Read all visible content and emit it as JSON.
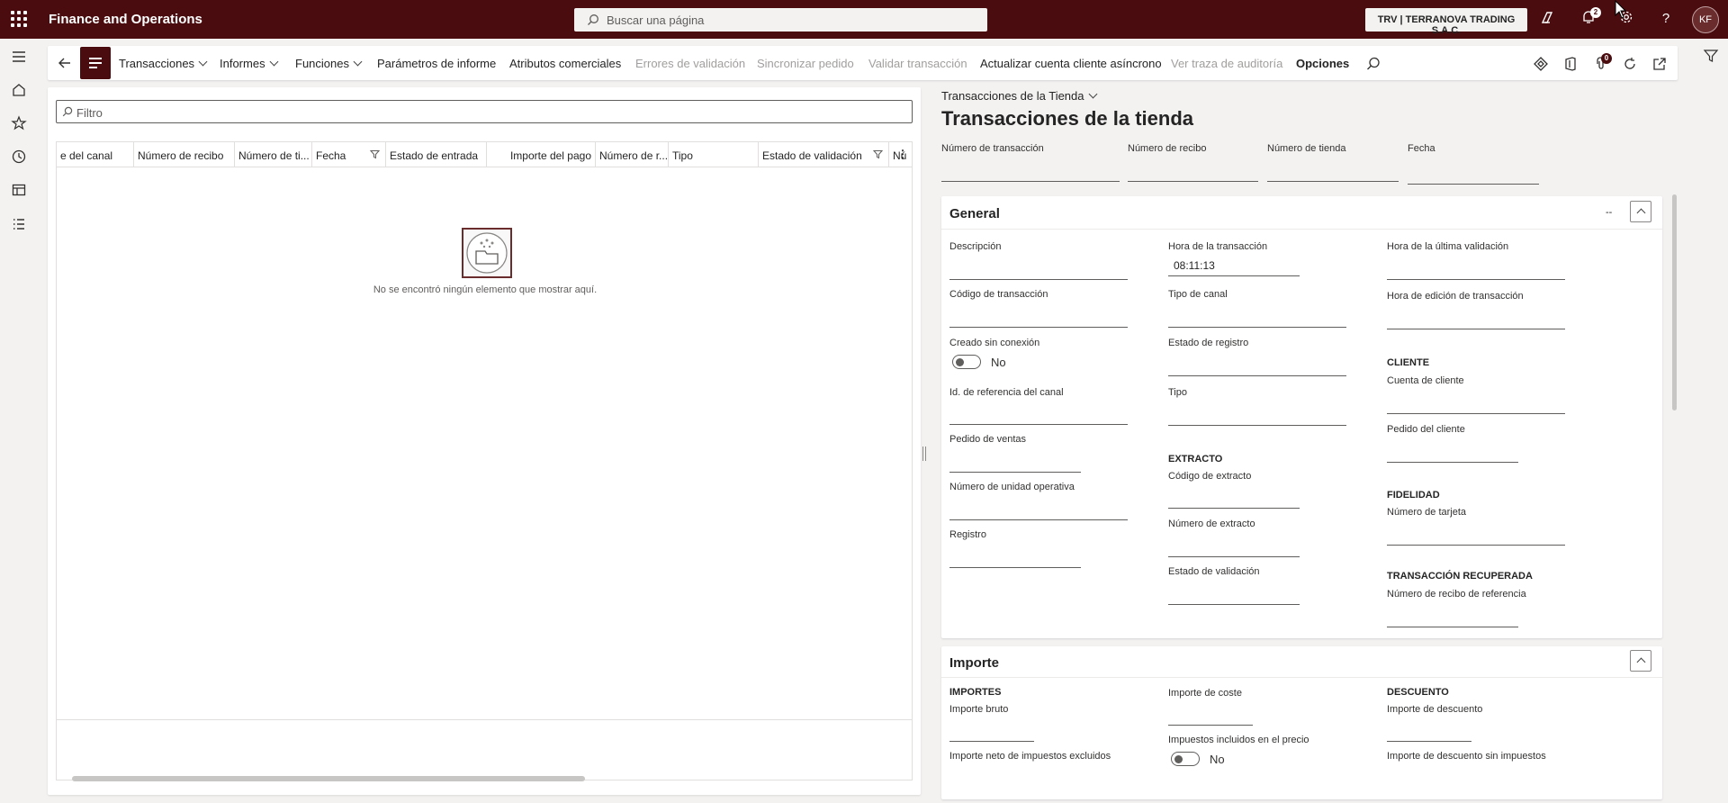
{
  "topbar": {
    "app_name": "Finance and Operations",
    "search_placeholder": "Buscar una página",
    "company": "TRV | TERRANOVA TRADING S.A.C.",
    "notifications_count": "2",
    "avatar_initials": "KF"
  },
  "actions": {
    "transacciones": "Transacciones",
    "informes": "Informes",
    "funciones": "Funciones",
    "parametros": "Parámetros de informe",
    "atributos": "Atributos comerciales",
    "errores": "Errores de validación",
    "sincronizar": "Sincronizar pedido",
    "validar": "Validar transacción",
    "actualizar": "Actualizar cuenta cliente asíncrono",
    "traza": "Ver traza de auditoría",
    "opciones": "Opciones",
    "attach_count": "0"
  },
  "list": {
    "filter_placeholder": "Filtro",
    "columns": [
      "e del canal",
      "Número de recibo",
      "Número de ti...",
      "Fecha",
      "Estado de entrada",
      "Importe del pago",
      "Número de r...",
      "Tipo",
      "Estado de validación",
      "Nú"
    ],
    "empty_message": "No se encontró ningún elemento que mostrar aquí."
  },
  "detail": {
    "breadcrumb": "Transacciones de la Tienda",
    "title": "Transacciones de la tienda",
    "header_fields": [
      "Número de transacción",
      "Número de recibo",
      "Número de tienda",
      "Fecha"
    ],
    "general": {
      "title": "General",
      "dash": "--",
      "descripcion": "Descripción",
      "hora_transaccion": "Hora de la transacción",
      "hora_transaccion_value": "08:11:13",
      "hora_ultima_validacion": "Hora de la última validación",
      "codigo_transaccion": "Código de transacción",
      "tipo_canal": "Tipo de canal",
      "hora_edicion": "Hora de edición de transacción",
      "creado_sin_conexion": "Creado sin conexión",
      "creado_sin_conexion_value": "No",
      "estado_registro": "Estado de registro",
      "cliente_section": "CLIENTE",
      "cuenta_cliente": "Cuenta de cliente",
      "id_referencia_canal": "Id. de referencia del canal",
      "tipo": "Tipo",
      "pedido_cliente": "Pedido del cliente",
      "pedido_ventas": "Pedido de ventas",
      "extracto_section": "EXTRACTO",
      "codigo_extracto": "Código de extracto",
      "fidelidad_section": "FIDELIDAD",
      "numero_tarjeta": "Número de tarjeta",
      "numero_unidad_operativa": "Número de unidad operativa",
      "numero_extracto": "Número de extracto",
      "registro": "Registro",
      "estado_validacion": "Estado de validación",
      "transaccion_recuperada_section": "TRANSACCIÓN RECUPERADA",
      "numero_recibo_referencia": "Número de recibo de referencia"
    },
    "importe": {
      "title": "Importe",
      "importes_section": "IMPORTES",
      "importe_bruto": "Importe bruto",
      "importe_neto": "Importe neto de impuestos excluidos",
      "importe_coste": "Importe de coste",
      "impuestos_incluidos": "Impuestos incluidos en el precio",
      "impuestos_incluidos_value": "No",
      "descuento_section": "DESCUENTO",
      "importe_descuento": "Importe de descuento",
      "importe_descuento_sin_impuestos": "Importe de descuento sin impuestos"
    }
  }
}
